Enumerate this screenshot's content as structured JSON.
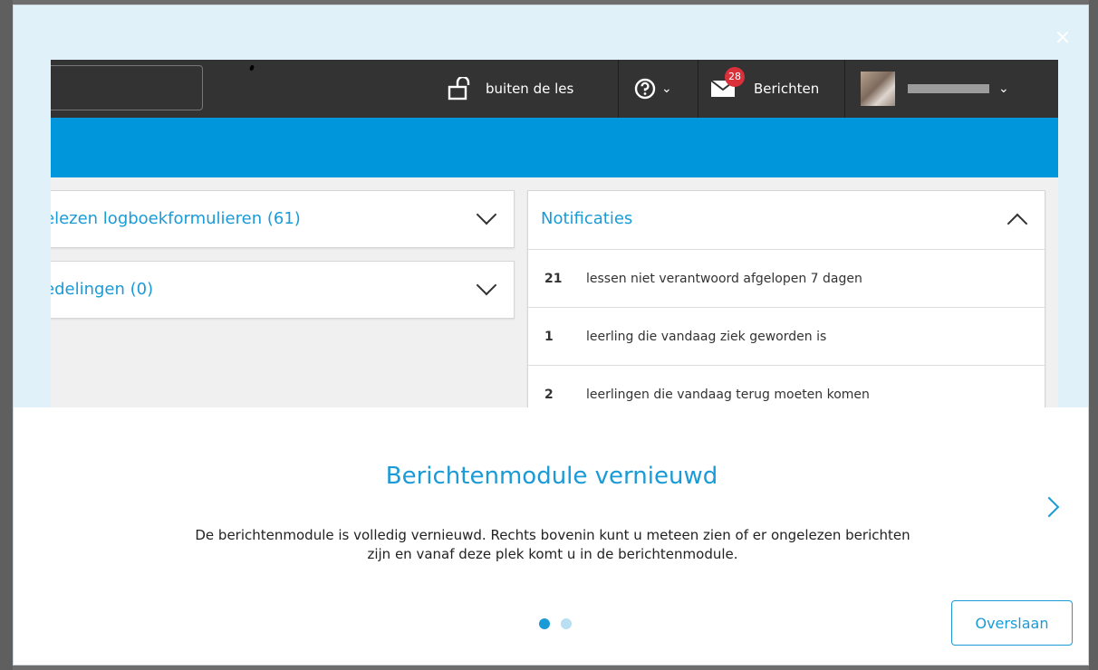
{
  "modal": {
    "close_label": "×",
    "slide_title": "Berichtenmodule vernieuwd",
    "slide_body": "De berichtenmodule is volledig vernieuwd. Rechts bovenin kunt u meteen zien of er ongelezen berichten zijn en vanaf deze plek komt u in de berichtenmodule.",
    "skip_label": "Overslaan",
    "current_slide": 1,
    "total_slides": 2
  },
  "preview": {
    "topbar": {
      "lock_label": "buiten de les",
      "messages_badge": "28",
      "messages_label": "Berichten",
      "user_name": "L. ▀▀▀▀▀"
    },
    "panels": {
      "logbook_title": "elezen logboekformulieren (61)",
      "announcements_title": "edelingen (0)",
      "notifications_title": "Notificaties"
    },
    "notifications": [
      {
        "count": "21",
        "text": "lessen niet verantwoord afgelopen 7 dagen"
      },
      {
        "count": "1",
        "text": "leerling die vandaag ziek geworden is"
      },
      {
        "count": "2",
        "text": "leerlingen die vandaag terug moeten komen"
      }
    ]
  },
  "colors": {
    "accent": "#1a9bd7",
    "blue_bar": "#0096dc",
    "topbar": "#333333",
    "badge": "#d9303a"
  }
}
